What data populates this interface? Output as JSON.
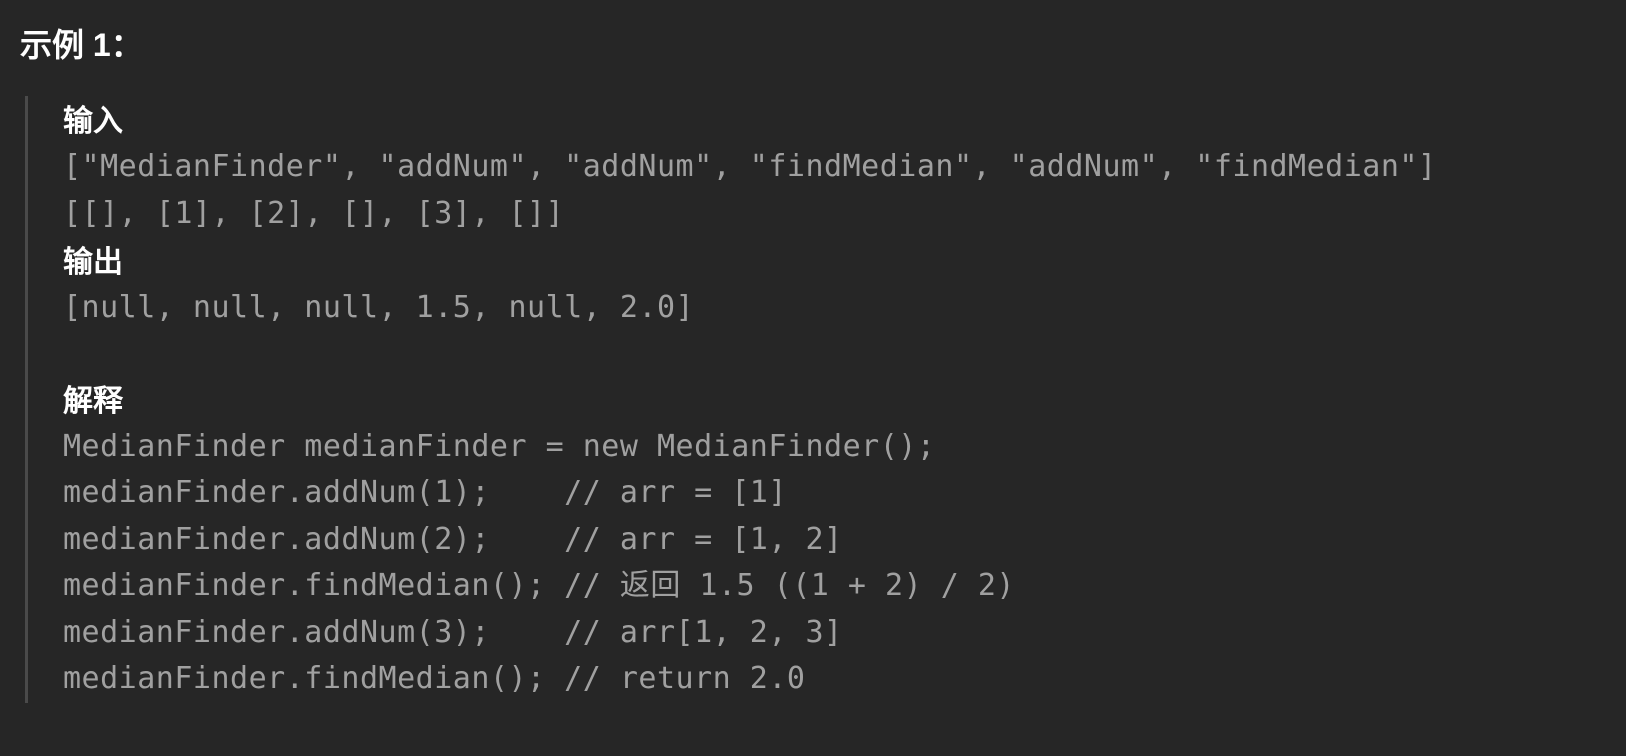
{
  "heading": "示例 1：",
  "labels": {
    "input": "输入",
    "output": "输出",
    "explanation": "解释"
  },
  "input_lines": [
    "[\"MedianFinder\", \"addNum\", \"addNum\", \"findMedian\", \"addNum\", \"findMedian\"]",
    "[[], [1], [2], [], [3], []]"
  ],
  "output_lines": [
    "[null, null, null, 1.5, null, 2.0]"
  ],
  "explanation_lines": [
    "MedianFinder medianFinder = new MedianFinder();",
    "medianFinder.addNum(1);    // arr = [1]",
    "medianFinder.addNum(2);    // arr = [1, 2]",
    "medianFinder.findMedian(); // 返回 1.5 ((1 + 2) / 2)",
    "medianFinder.addNum(3);    // arr[1, 2, 3]",
    "medianFinder.findMedian(); // return 2.0"
  ]
}
